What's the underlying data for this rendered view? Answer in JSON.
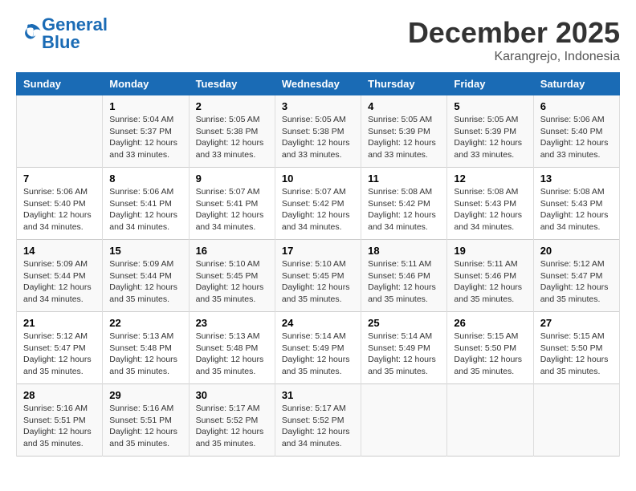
{
  "logo": {
    "text_general": "General",
    "text_blue": "Blue"
  },
  "title": "December 2025",
  "location": "Karangrejo, Indonesia",
  "weekdays": [
    "Sunday",
    "Monday",
    "Tuesday",
    "Wednesday",
    "Thursday",
    "Friday",
    "Saturday"
  ],
  "weeks": [
    [
      {
        "day": "",
        "info": ""
      },
      {
        "day": "1",
        "info": "Sunrise: 5:04 AM\nSunset: 5:37 PM\nDaylight: 12 hours\nand 33 minutes."
      },
      {
        "day": "2",
        "info": "Sunrise: 5:05 AM\nSunset: 5:38 PM\nDaylight: 12 hours\nand 33 minutes."
      },
      {
        "day": "3",
        "info": "Sunrise: 5:05 AM\nSunset: 5:38 PM\nDaylight: 12 hours\nand 33 minutes."
      },
      {
        "day": "4",
        "info": "Sunrise: 5:05 AM\nSunset: 5:39 PM\nDaylight: 12 hours\nand 33 minutes."
      },
      {
        "day": "5",
        "info": "Sunrise: 5:05 AM\nSunset: 5:39 PM\nDaylight: 12 hours\nand 33 minutes."
      },
      {
        "day": "6",
        "info": "Sunrise: 5:06 AM\nSunset: 5:40 PM\nDaylight: 12 hours\nand 33 minutes."
      }
    ],
    [
      {
        "day": "7",
        "info": "Sunrise: 5:06 AM\nSunset: 5:40 PM\nDaylight: 12 hours\nand 34 minutes."
      },
      {
        "day": "8",
        "info": "Sunrise: 5:06 AM\nSunset: 5:41 PM\nDaylight: 12 hours\nand 34 minutes."
      },
      {
        "day": "9",
        "info": "Sunrise: 5:07 AM\nSunset: 5:41 PM\nDaylight: 12 hours\nand 34 minutes."
      },
      {
        "day": "10",
        "info": "Sunrise: 5:07 AM\nSunset: 5:42 PM\nDaylight: 12 hours\nand 34 minutes."
      },
      {
        "day": "11",
        "info": "Sunrise: 5:08 AM\nSunset: 5:42 PM\nDaylight: 12 hours\nand 34 minutes."
      },
      {
        "day": "12",
        "info": "Sunrise: 5:08 AM\nSunset: 5:43 PM\nDaylight: 12 hours\nand 34 minutes."
      },
      {
        "day": "13",
        "info": "Sunrise: 5:08 AM\nSunset: 5:43 PM\nDaylight: 12 hours\nand 34 minutes."
      }
    ],
    [
      {
        "day": "14",
        "info": "Sunrise: 5:09 AM\nSunset: 5:44 PM\nDaylight: 12 hours\nand 34 minutes."
      },
      {
        "day": "15",
        "info": "Sunrise: 5:09 AM\nSunset: 5:44 PM\nDaylight: 12 hours\nand 35 minutes."
      },
      {
        "day": "16",
        "info": "Sunrise: 5:10 AM\nSunset: 5:45 PM\nDaylight: 12 hours\nand 35 minutes."
      },
      {
        "day": "17",
        "info": "Sunrise: 5:10 AM\nSunset: 5:45 PM\nDaylight: 12 hours\nand 35 minutes."
      },
      {
        "day": "18",
        "info": "Sunrise: 5:11 AM\nSunset: 5:46 PM\nDaylight: 12 hours\nand 35 minutes."
      },
      {
        "day": "19",
        "info": "Sunrise: 5:11 AM\nSunset: 5:46 PM\nDaylight: 12 hours\nand 35 minutes."
      },
      {
        "day": "20",
        "info": "Sunrise: 5:12 AM\nSunset: 5:47 PM\nDaylight: 12 hours\nand 35 minutes."
      }
    ],
    [
      {
        "day": "21",
        "info": "Sunrise: 5:12 AM\nSunset: 5:47 PM\nDaylight: 12 hours\nand 35 minutes."
      },
      {
        "day": "22",
        "info": "Sunrise: 5:13 AM\nSunset: 5:48 PM\nDaylight: 12 hours\nand 35 minutes."
      },
      {
        "day": "23",
        "info": "Sunrise: 5:13 AM\nSunset: 5:48 PM\nDaylight: 12 hours\nand 35 minutes."
      },
      {
        "day": "24",
        "info": "Sunrise: 5:14 AM\nSunset: 5:49 PM\nDaylight: 12 hours\nand 35 minutes."
      },
      {
        "day": "25",
        "info": "Sunrise: 5:14 AM\nSunset: 5:49 PM\nDaylight: 12 hours\nand 35 minutes."
      },
      {
        "day": "26",
        "info": "Sunrise: 5:15 AM\nSunset: 5:50 PM\nDaylight: 12 hours\nand 35 minutes."
      },
      {
        "day": "27",
        "info": "Sunrise: 5:15 AM\nSunset: 5:50 PM\nDaylight: 12 hours\nand 35 minutes."
      }
    ],
    [
      {
        "day": "28",
        "info": "Sunrise: 5:16 AM\nSunset: 5:51 PM\nDaylight: 12 hours\nand 35 minutes."
      },
      {
        "day": "29",
        "info": "Sunrise: 5:16 AM\nSunset: 5:51 PM\nDaylight: 12 hours\nand 35 minutes."
      },
      {
        "day": "30",
        "info": "Sunrise: 5:17 AM\nSunset: 5:52 PM\nDaylight: 12 hours\nand 35 minutes."
      },
      {
        "day": "31",
        "info": "Sunrise: 5:17 AM\nSunset: 5:52 PM\nDaylight: 12 hours\nand 34 minutes."
      },
      {
        "day": "",
        "info": ""
      },
      {
        "day": "",
        "info": ""
      },
      {
        "day": "",
        "info": ""
      }
    ]
  ]
}
